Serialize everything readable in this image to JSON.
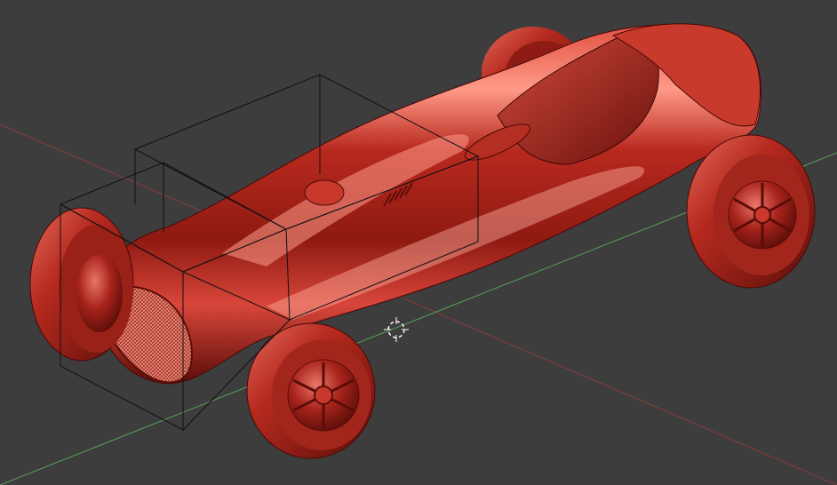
{
  "viewport": {
    "background": "#3d3d3d",
    "axis_x_color": "#8a3b3b",
    "axis_y_color": "#5aa05a",
    "model_color": "#a8231c",
    "model_highlight": "#ff9a8a",
    "model_shadow": "#4a0806",
    "bbox_color": "#101010"
  },
  "objects": {
    "model": "race-car",
    "selection": "bounding-box",
    "cursor": "3d-cursor"
  }
}
